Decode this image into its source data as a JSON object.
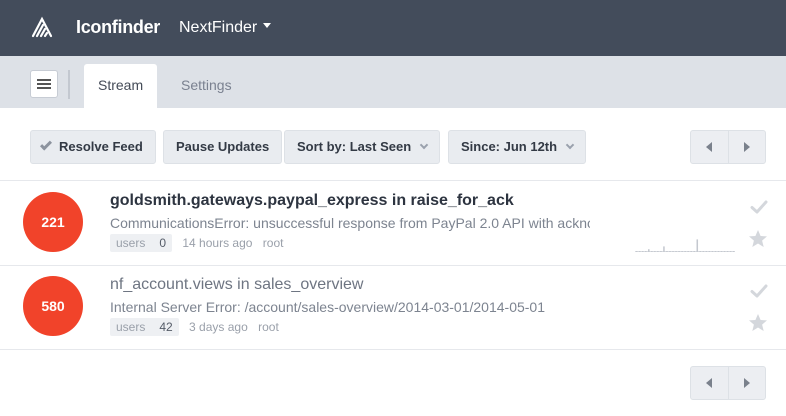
{
  "header": {
    "brand": "Iconfinder",
    "project": "NextFinder",
    "colors": {
      "bar": "#434c5b"
    }
  },
  "tabs": [
    {
      "label": "Stream",
      "active": true
    },
    {
      "label": "Settings",
      "active": false
    }
  ],
  "toolbar": {
    "resolve_label": "Resolve Feed",
    "pause_label": "Pause Updates",
    "sort_label": "Sort by: Last Seen",
    "since_label": "Since: Jun 12th"
  },
  "events": [
    {
      "count": "221",
      "title": "goldsmith.gateways.paypal_express in raise_for_ack",
      "message": "CommunicationsError: unsuccessful response from PayPal 2.0 API with ackno...",
      "users_label": "users",
      "users_count": "0",
      "time": "14 hours ago",
      "logger": "root",
      "spark": [
        0.05,
        0.05,
        0.05,
        0.05,
        0.2,
        0.05,
        0.05,
        0.05,
        0.05,
        0.4,
        0.05,
        0.05,
        0.05,
        0.05,
        0.05,
        0.05,
        0.05,
        0.05,
        0.05,
        0.05,
        0.9,
        0.05,
        0.05,
        0.05,
        0.05,
        0.05,
        0.05,
        0.05,
        0.05,
        0.05,
        0.05,
        0.05,
        0.05
      ]
    },
    {
      "count": "580",
      "title": "nf_account.views in sales_overview",
      "message": "Internal Server Error: /account/sales-overview/2014-03-01/2014-05-01",
      "users_label": "users",
      "users_count": "42",
      "time": "3 days ago",
      "logger": "root"
    }
  ],
  "colors": {
    "count_badge": "#f1432a",
    "tabbar": "#dde1e7"
  }
}
